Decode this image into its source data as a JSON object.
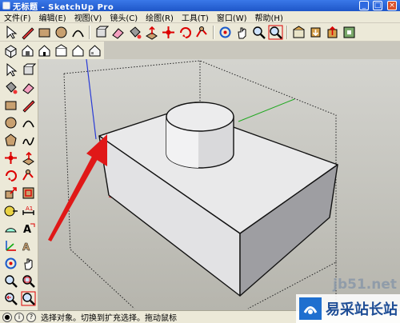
{
  "window": {
    "title": "无标题 - SketchUp Pro",
    "minimize_glyph": "_",
    "maximize_glyph": "□",
    "close_glyph": "×"
  },
  "menu": [
    {
      "label": "文件(F)"
    },
    {
      "label": "编辑(E)"
    },
    {
      "label": "视图(V)"
    },
    {
      "label": "镜头(C)"
    },
    {
      "label": "绘图(R)"
    },
    {
      "label": "工具(T)"
    },
    {
      "label": "窗口(W)"
    },
    {
      "label": "帮助(H)"
    }
  ],
  "toolbar_top": [
    "select-arrow-icon",
    "pencil-line-icon",
    "rectangle-icon",
    "circle-icon",
    "arc-icon",
    "make-component-icon",
    "eraser-icon",
    "paint-bucket-icon",
    "push-pull-icon",
    "move-icon",
    "rotate-icon",
    "follow-me-icon",
    "orbit-icon",
    "pan-icon",
    "zoom-icon",
    "zoom-extents-icon",
    "warehouse-icon",
    "get-models-icon",
    "share-model-icon",
    "extension-icon"
  ],
  "toolbar_views": [
    "iso-view-icon",
    "top-view-icon",
    "front-view-icon",
    "right-view-icon",
    "back-view-icon",
    "left-view-icon"
  ],
  "toolbar_left": [
    "select-arrow-icon",
    "make-component-icon",
    "paint-bucket-icon",
    "eraser-icon",
    "rectangle-icon",
    "pencil-line-icon",
    "circle-icon",
    "arc-icon",
    "polygon-icon",
    "freehand-icon",
    "move-icon",
    "push-pull-icon",
    "rotate-icon",
    "follow-me-icon",
    "scale-icon",
    "offset-icon",
    "tape-measure-icon",
    "dimension-icon",
    "protractor-icon",
    "text-icon",
    "axes-icon",
    "3d-text-icon",
    "orbit-icon",
    "pan-icon",
    "zoom-icon",
    "zoom-window-icon",
    "previous-view-icon",
    "zoom-extents-icon"
  ],
  "status": {
    "hint": "选择对象。切换到扩充选择。拖动鼠标"
  },
  "watermark": {
    "url": "jb51.net",
    "brand": "易采站长站"
  }
}
